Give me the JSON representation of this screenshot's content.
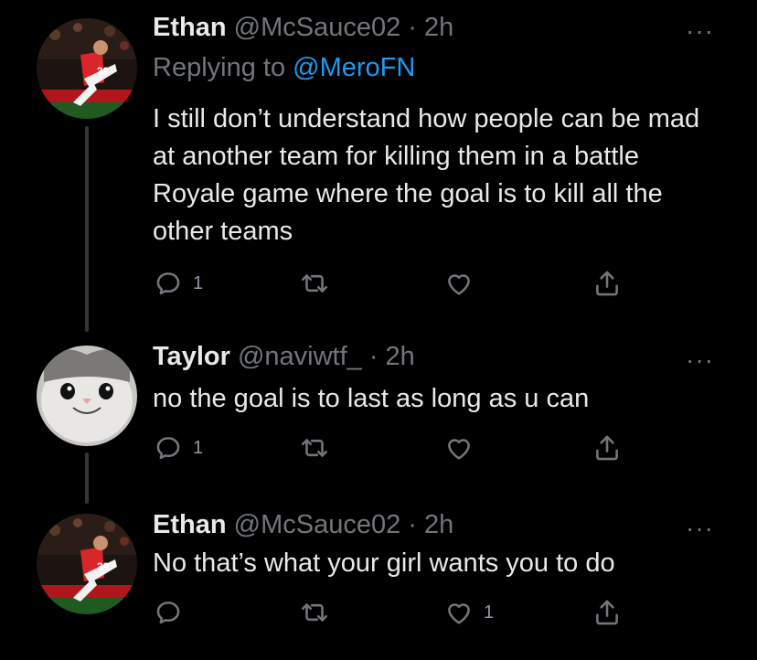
{
  "tweets": [
    {
      "name": "Ethan",
      "handle": "@McSauce02",
      "time": "· 2h",
      "replying_prefix": "Replying to",
      "replying_to": "@MeroFN",
      "text": "I still don’t understand how people can be mad at another team for killing them in a battle Royale game where the goal is to kill all the other teams",
      "replies": "1",
      "retweets": "",
      "likes": "",
      "more": "···"
    },
    {
      "name": "Taylor",
      "handle": "@naviwtf_",
      "time": "· 2h",
      "text": "no the goal is to last as long as u can",
      "replies": "1",
      "retweets": "",
      "likes": "",
      "more": "···"
    },
    {
      "name": "Ethan",
      "handle": "@McSauce02",
      "time": "· 2h",
      "text": "No that’s what your girl wants you to do",
      "replies": "",
      "retweets": "",
      "likes": "1",
      "more": "···"
    }
  ],
  "colors": {
    "background": "#000000",
    "text": "#e7e9ea",
    "muted": "#71767b",
    "link": "#1d9bf0"
  },
  "icons": [
    "reply-icon",
    "retweet-icon",
    "like-icon",
    "share-icon",
    "more-icon"
  ]
}
